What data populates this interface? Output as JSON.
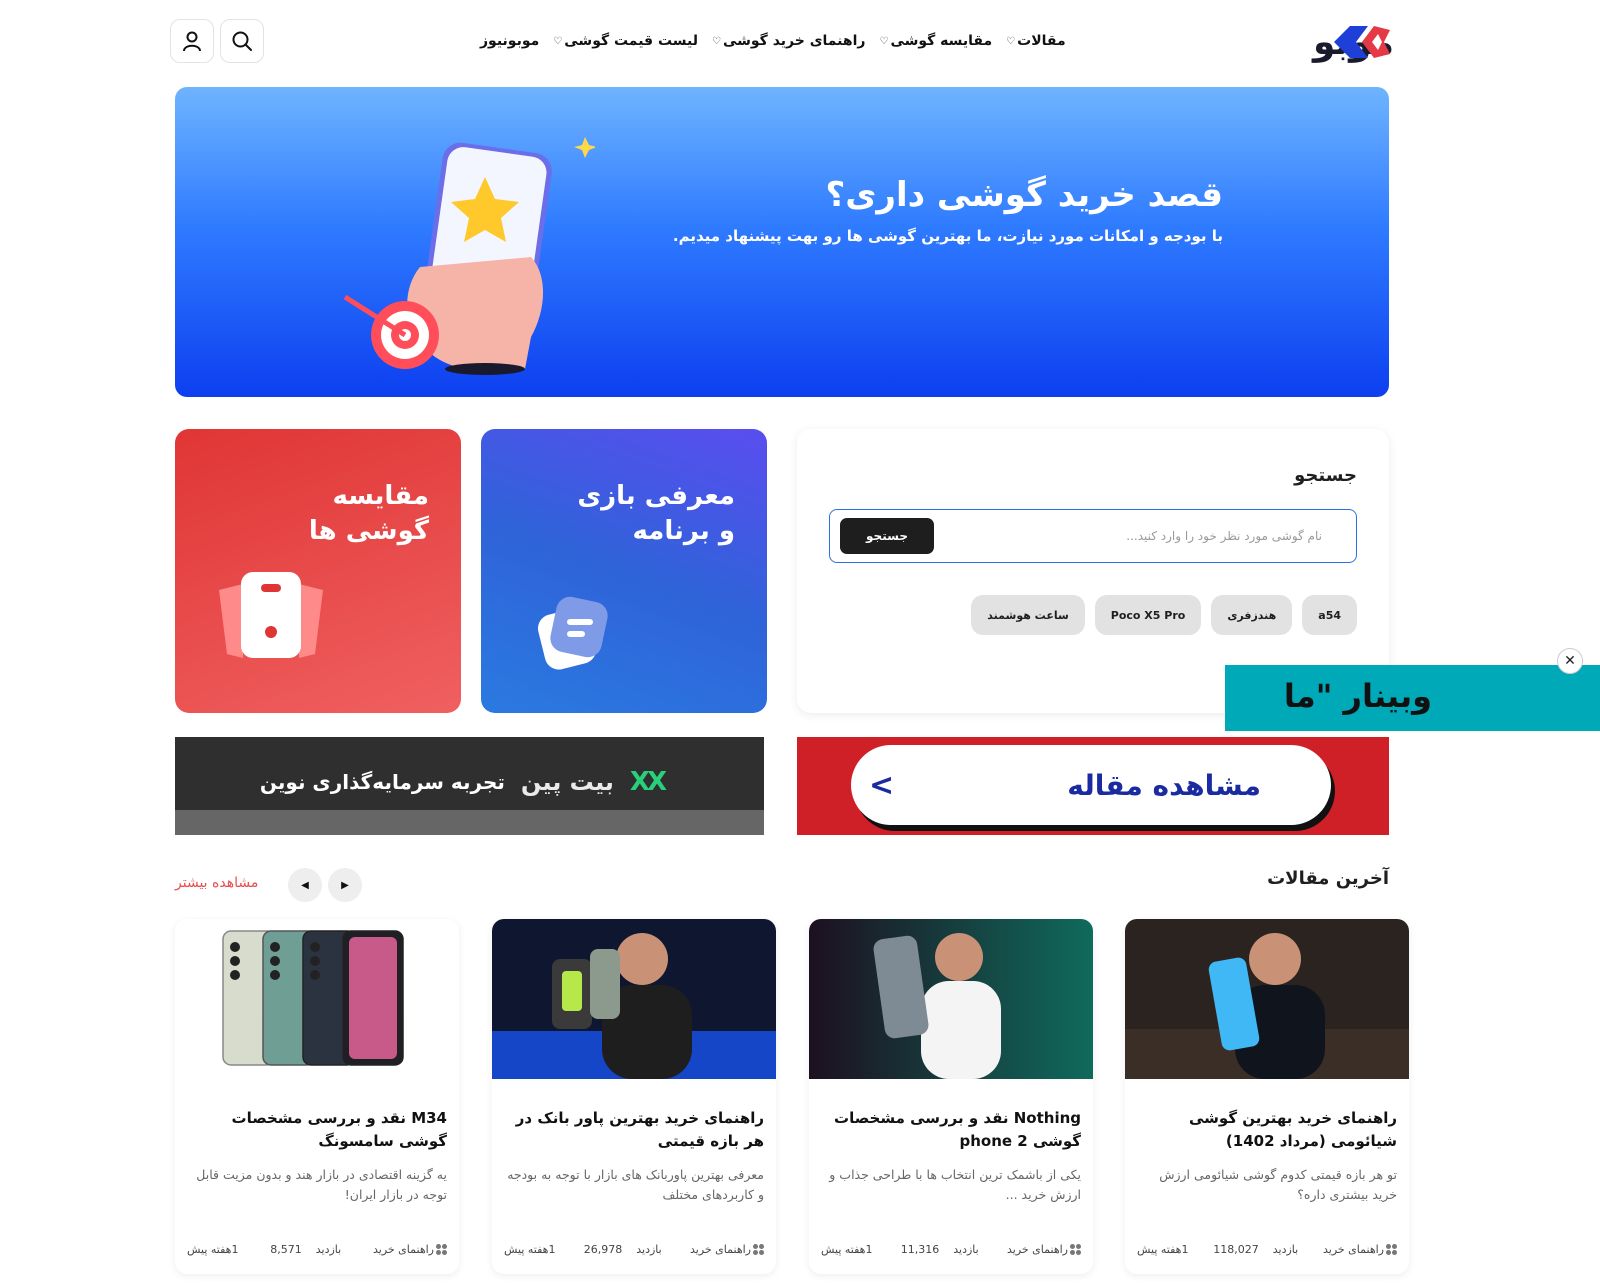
{
  "header": {
    "logo_text": "موبو",
    "nav": [
      {
        "label": "موبونیوز",
        "has_dropdown": false
      },
      {
        "label": "لیست قیمت گوشی",
        "has_dropdown": true
      },
      {
        "label": "راهنمای خرید گوشی",
        "has_dropdown": true
      },
      {
        "label": "مقایسه گوشی",
        "has_dropdown": true
      },
      {
        "label": "مقالات",
        "has_dropdown": true
      }
    ],
    "icons": {
      "search": "search-icon",
      "user": "user-icon"
    }
  },
  "hero": {
    "title": "قصد خرید گوشی داری؟",
    "subtitle": "با بودجه و امکانات مورد نیازت، ما بهترین گوشی ها رو بهت پیشنهاد میدیم."
  },
  "search": {
    "title": "جستجو",
    "placeholder": "نام گوشی مورد نظر خود را وارد کنید...",
    "button": "جستجو",
    "tags": [
      "a54",
      "هندزفری",
      "Poco X5 Pro",
      "ساعت هوشمند"
    ]
  },
  "features": {
    "games": "معرفی بازی\nو برنامه",
    "compare": "مقایسه\nگوشی ها"
  },
  "webinar": {
    "text": "وبینار \"ما"
  },
  "banners": {
    "bitpin_tagline": "تجربه سرمایه‌گذاری نوین",
    "bitpin_brand": "بیت پین",
    "article_cta": "مشاهده مقاله"
  },
  "latest": {
    "title": "آخرین مقالات",
    "more": "مشاهده بیشتر",
    "articles": [
      {
        "title": "راهنمای خرید بهترین گوشی شیائومی (مرداد 1402)",
        "desc": "تو هر بازه قیمتی کدوم گوشی شیائومی ارزش خرید بیشتری داره؟",
        "category": "راهنمای خرید",
        "views_label": "بازدید",
        "views": "118,027",
        "time": "1هفته پیش"
      },
      {
        "title": "Nothing نقد و بررسی مشخصات گوشی phone 2",
        "desc": "یکی از باشمک ترین انتخاب ها با طراحی جذاب و ارزش خرید ...",
        "category": "راهنمای خرید",
        "views_label": "بازدید",
        "views": "11,316",
        "time": "1هفته پیش"
      },
      {
        "title": "راهنمای خرید بهترین پاور بانک در هر بازه قیمتی",
        "desc": "معرفی بهترین پاوربانک های بازار با توجه به بودجه و کاربردهای مختلف",
        "category": "راهنمای خرید",
        "views_label": "بازدید",
        "views": "26,978",
        "time": "1هفته پیش"
      },
      {
        "title": "M34 نقد و بررسی مشخصات گوشی سامسونگ",
        "desc": "یه گزینه اقتصادی در بازار هند و بدون مزیت قابل توجه در بازار ایران!",
        "category": "راهنمای خرید",
        "views_label": "بازدید",
        "views": "8,571",
        "time": "1هفته پیش"
      }
    ]
  },
  "colors": {
    "accent_red": "#e03535",
    "accent_blue": "#2f6fe6",
    "webinar": "#00a9b8",
    "more_link": "#e84d4d"
  }
}
